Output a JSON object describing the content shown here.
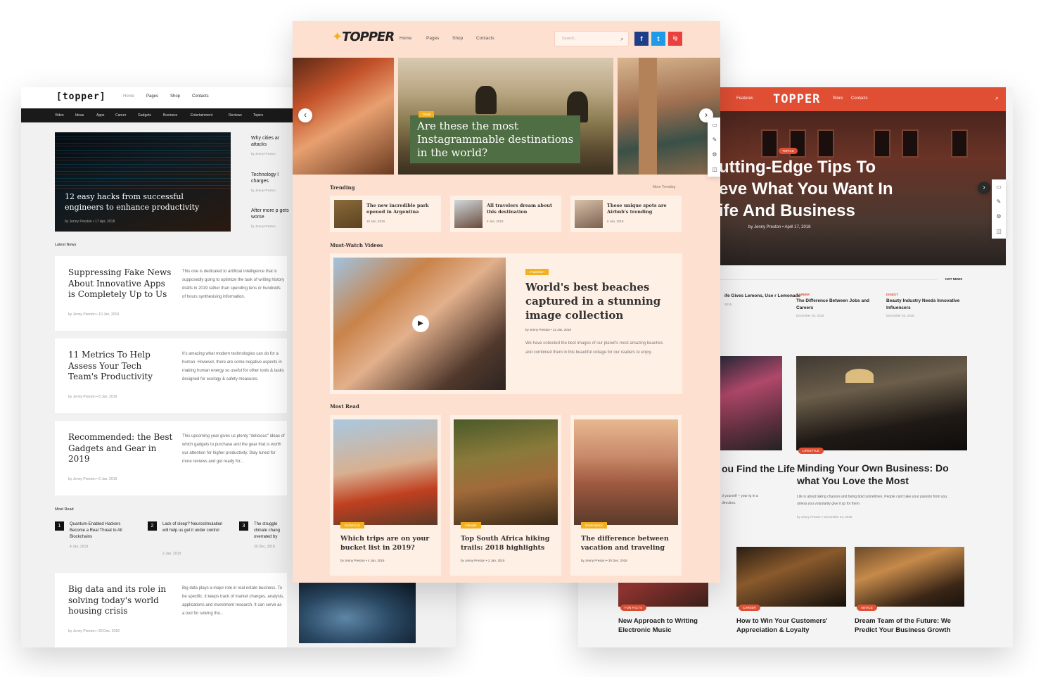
{
  "left": {
    "logo": "[topper]",
    "nav": [
      "Home",
      "Pages",
      "Shop",
      "Contacts"
    ],
    "categories": [
      "Video",
      "Ideas",
      "Apps",
      "Career",
      "Gadgets",
      "Business",
      "Entertainment",
      "Reviews",
      "Topics"
    ],
    "hero": {
      "title": "12 easy hacks from successful engineers to enhance productivity",
      "meta": "by Jenny Preston  •  17 Apr, 2018"
    },
    "side": [
      {
        "title": "Why cities ar attacks",
        "meta": "by Jenny Preston"
      },
      {
        "title": "Technology l charges",
        "meta": "by Jenny Preston"
      },
      {
        "title": "After more p gets worse",
        "meta": "by Jenny Preston"
      }
    ],
    "latest_label": "Latest News",
    "news": [
      {
        "title": "Suppressing Fake News About Innovative Apps is Completely Up to Us",
        "desc": "This one is dedicated to artificial intelligence that is supposedly going to optimize the task of writing history drafts in 2019 rather than spending tens or hundreds of hours synthesising information.",
        "meta": "by Jenny Preston  •  10 Jan, 2019"
      },
      {
        "title": "11 Metrics To Help Assess Your Tech Team's Productivity",
        "desc": "It's amazing what modern technologies can do for a human. However, there are some negative aspects in making human energy so useful for other tools & tasks designed for ecology & safety measures.",
        "meta": "by Jenny Preston  •  8 Jan, 2019"
      },
      {
        "title": "Recommended: the Best Gadgets and Gear in 2019",
        "desc": "This upcoming year gives us plenty \"delicious\" ideas of which gadgets to purchase and the gear that is worth our attention for higher productivity. Stay tuned for more reviews and get ready for...",
        "meta": "by Jenny Preston  •  6 Jan, 2019"
      }
    ],
    "most_read_label": "Most Read",
    "most_read": [
      {
        "num": "1",
        "title": "Quantum-Enabled Hackers Become a Real Threat to All Blockchains",
        "date": "4 Jan, 2019"
      },
      {
        "num": "2",
        "title": "Lack of sleep? Neurostimulation will help us get it under control",
        "date": "2 Jan, 2019"
      },
      {
        "num": "3",
        "title": "The struggle climate chang overrated by",
        "date": "30 Dec, 2018"
      }
    ],
    "bottom": {
      "title": "Big data and its role in solving today's world housing crisis",
      "desc": "Big data plays a major role in real estate business. To be specific, it keeps track of market changes, analysis, applications and investment research. It can serve as a tool for solving the...",
      "meta": "by Jenny Preston  •  26 Dec, 2018"
    }
  },
  "center": {
    "logo": "TOPPER",
    "nav": [
      "Home",
      "Pages",
      "Shop",
      "Contacts"
    ],
    "search_placeholder": "Search...",
    "social": [
      "f",
      "t",
      "ig"
    ],
    "featured": {
      "tag": "Travel",
      "title": "Are these the most Instagrammable destinations in the world?"
    },
    "trending_label": "Trending",
    "more_trending": "More Trending",
    "trending": [
      {
        "title": "The new incredible park opened in Argentina",
        "date": "10 Jan, 2019"
      },
      {
        "title": "All travelers dream about this destination",
        "date": "8 Jan, 2019"
      },
      {
        "title": "These unique spots are Airbnb's trending",
        "date": "6 Jan, 2019"
      }
    ],
    "videos_label": "Must-Watch Videos",
    "video": {
      "tag": "Inspiration",
      "title": "World's best beaches captured in a stunning image collection",
      "meta": "by Jenny Preston  •  12 Jan, 2019",
      "desc": "We have collected the best images of our planet's most amazing beaches and combined them in this beautiful collage for our readers to enjoy."
    },
    "most_read_label": "Most Read",
    "most_read": [
      {
        "tag": "Bucket List",
        "title": "Which trips are on your bucket list in 2019?",
        "meta": "by Jenny Preston  •  4 Jan, 2019"
      },
      {
        "tag": "Lifestyle",
        "title": "Top South Africa hiking trails: 2018 highlights",
        "meta": "by Jenny Preston  •  2 Jan, 2019"
      },
      {
        "tag": "Destinations",
        "title": "The difference between vacation and traveling",
        "meta": "by Jenny Preston  •  30 Dec, 2018"
      }
    ]
  },
  "right": {
    "logo": "TOPPER",
    "nav": [
      "Features",
      "Store",
      "Contacts"
    ],
    "hero": {
      "tag": "TOPICS",
      "title_lines": [
        "utting-Edge Tips To",
        "eve What You Want In",
        "ife And Business"
      ],
      "meta": "by Jenny Preston  •  April 17, 2018"
    },
    "hot_news": "HOT NEWS",
    "top3": [
      {
        "cat": "",
        "title": "ife Gives Lemons, Use r Lemonade",
        "date": "2019"
      },
      {
        "cat": "CAREER",
        "title": "The Difference Between Jobs and Careers",
        "date": "December 30, 2018"
      },
      {
        "cat": "DIGEST",
        "title": "Beauty Industry Needs Innovative Influencers",
        "date": "December 26, 2018"
      }
    ],
    "mid_left": {
      "title": "ou Find the Life",
      "desc": "d yourself – your ig in a direction."
    },
    "mid_right": {
      "tag": "LIFESTYLE",
      "title": "Minding Your Own Business: Do what You Love the Most",
      "desc": "Life is about taking chances and being bold sometimes. People can't take your passion from you, unless you voluntarily give it up for them.",
      "meta": "by Jenny Preston  •  December 24, 2018"
    },
    "bottom": [
      {
        "tag": "FUN FACTS",
        "title": "New Approach to Writing Electronic Music"
      },
      {
        "tag": "CAREER",
        "title": "How to Win Your Customers' Appreciation & Loyalty"
      },
      {
        "tag": "ADVICE",
        "title": "Dream Team of the Future: We Predict Your Business Growth"
      }
    ]
  },
  "colors": {
    "center_bg": "#fde0d0",
    "accent_yellow": "#f2b01e",
    "right_accent": "#e04e34",
    "green_box": "#4f6e43"
  }
}
